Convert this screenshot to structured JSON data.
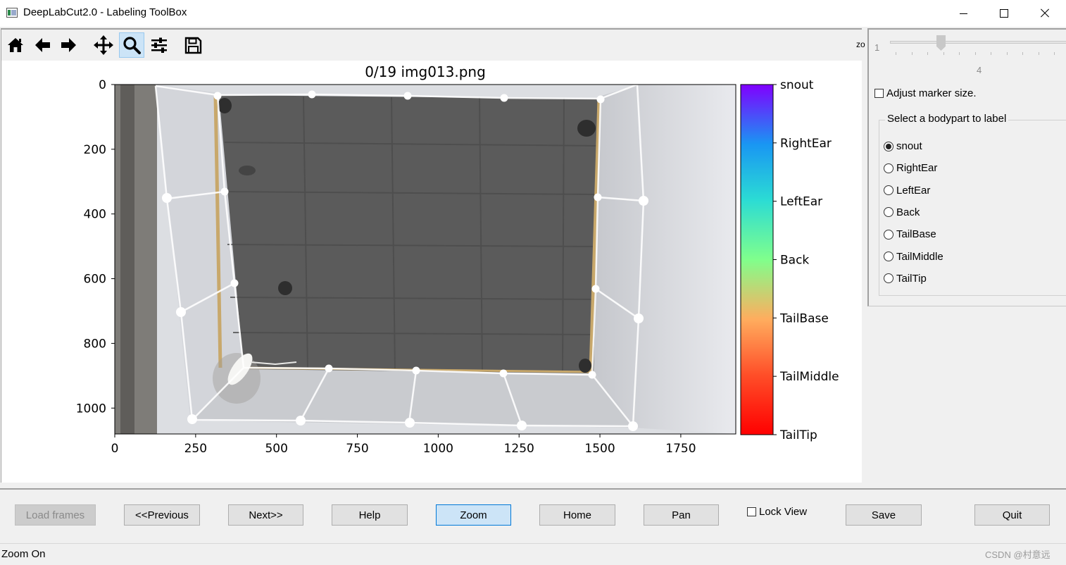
{
  "window": {
    "title": "DeepLabCut2.0 - Labeling ToolBox",
    "controls": [
      "minimize",
      "maximize",
      "close"
    ]
  },
  "toolbar": {
    "icons": [
      "home-icon",
      "back-arrow-icon",
      "forward-arrow-icon",
      "pan-move-icon",
      "zoom-magnifier-icon",
      "configure-sliders-icon",
      "save-floppy-icon"
    ],
    "active": "zoom-magnifier-icon",
    "clipped_label": "zo"
  },
  "plot": {
    "title": "0/19 img013.png",
    "x_ticks": [
      "0",
      "250",
      "500",
      "750",
      "1000",
      "1250",
      "1500",
      "1750"
    ],
    "x_tick_values": [
      0,
      250,
      500,
      750,
      1000,
      1250,
      1500,
      1750
    ],
    "y_ticks": [
      "0",
      "200",
      "400",
      "600",
      "800",
      "1000"
    ],
    "y_tick_values": [
      0,
      200,
      400,
      600,
      800,
      1000
    ],
    "xlim": [
      0,
      1920
    ],
    "ylim": [
      1080,
      0
    ],
    "image_colors": {
      "floor": "#5b5b5b",
      "frame": "#d9dbe0",
      "wall": "#cfd1d6"
    }
  },
  "colorbar": {
    "colormap": "rainbow",
    "labels": [
      "snout",
      "RightEar",
      "LeftEar",
      "Back",
      "TailBase",
      "TailMiddle",
      "TailTip"
    ],
    "colors": [
      "#8000ff",
      "#1996f3",
      "#4df3ce",
      "#b2f396",
      "#ff9c4f",
      "#ff1a0e",
      "#ff0000"
    ]
  },
  "right_panel": {
    "slider": {
      "min_label": "1",
      "value_label": "4",
      "value": 4,
      "min": 1,
      "max": 12
    },
    "adjust_marker_label": "Adjust marker size.",
    "adjust_marker_checked": false,
    "group_title": "Select a bodypart to label",
    "bodyparts": [
      "snout",
      "RightEar",
      "LeftEar",
      "Back",
      "TailBase",
      "TailMiddle",
      "TailTip"
    ],
    "selected": "snout"
  },
  "buttons": {
    "load_frames": "Load frames",
    "previous": "<<Previous",
    "next": "Next>>",
    "help": "Help",
    "zoom": "Zoom",
    "home": "Home",
    "pan": "Pan",
    "lock_view": "Lock View",
    "save": "Save",
    "quit": "Quit"
  },
  "lock_view_checked": false,
  "status": {
    "text": "Zoom On",
    "watermark": "CSDN @村意远"
  }
}
